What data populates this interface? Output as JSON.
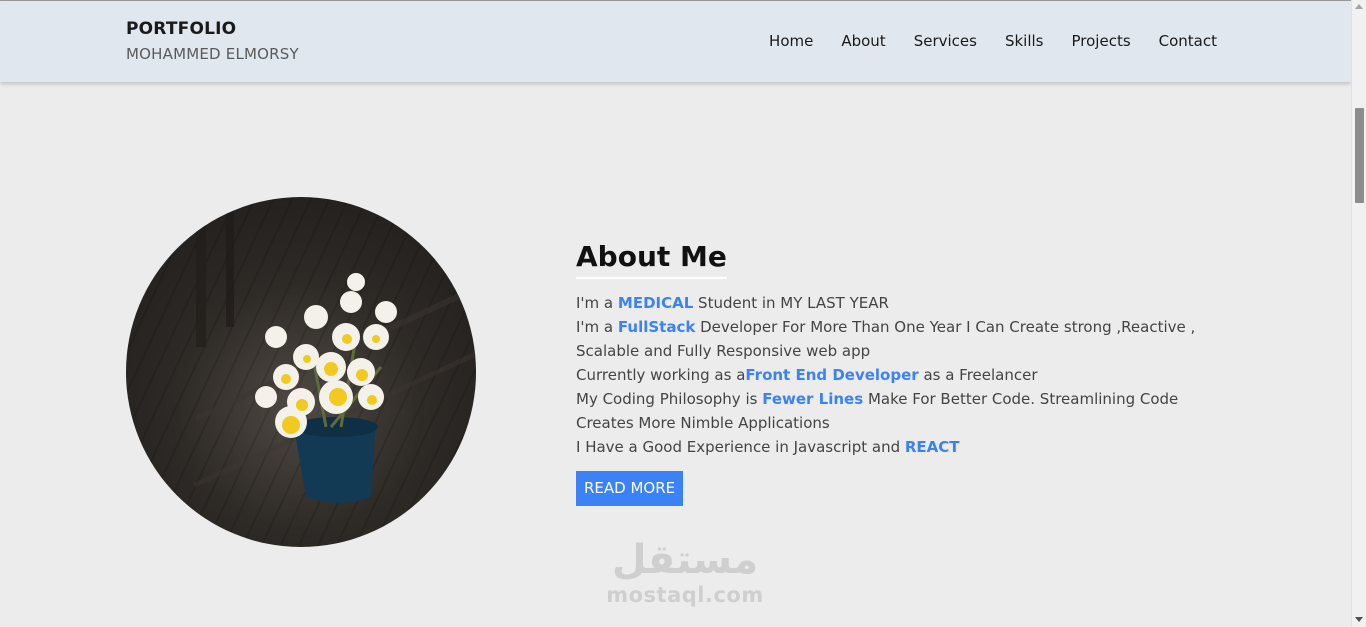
{
  "brand": {
    "title": "PORTFOLIO",
    "subtitle": "MOHAMMED ELMORSY"
  },
  "nav": {
    "items": [
      "Home",
      "About",
      "Services",
      "Skills",
      "Projects",
      "Contact"
    ]
  },
  "about": {
    "heading": "About Me",
    "line1_pre": "I'm a ",
    "line1_hl": "MEDICAL",
    "line1_post": " Student in MY LAST YEAR",
    "line2_pre": "I'm a ",
    "line2_hl": "FullStack",
    "line2_post": " Developer For More Than One Year I Can Create strong ,Reactive , Scalable and Fully Responsive web app",
    "line3_pre": "Currently working as a",
    "line3_hl": "Front End Developer",
    "line3_post": " as a Freelancer",
    "line4_pre": "My Coding Philosophy is ",
    "line4_hl": "Fewer Lines",
    "line4_post": " Make For Better Code. Streamlining Code Creates More Nimble Applications",
    "line5_pre": "I Have a Good Experience in Javascript and ",
    "line5_hl": "REACT",
    "button_label": "READ MORE"
  },
  "watermark": {
    "arabic": "مستقل",
    "latin": "mostaql.com"
  },
  "colors": {
    "accent": "#3b82f6",
    "header_bg": "#e1e7ef",
    "page_bg": "#ececec"
  },
  "icons": {
    "photo": "flower-vase-image"
  }
}
